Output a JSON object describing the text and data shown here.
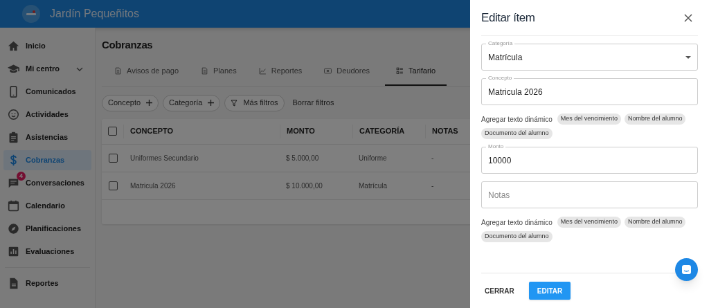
{
  "header": {
    "title": "Jardín Pequeñitos"
  },
  "sidebar": {
    "items": [
      {
        "label": "Inicio",
        "selected": false
      },
      {
        "label": "Mi centro",
        "selected": false,
        "expandable": true
      },
      {
        "label": "Comunicados",
        "selected": false
      },
      {
        "label": "Actividades",
        "selected": false
      },
      {
        "label": "Asistencias",
        "selected": false
      },
      {
        "label": "Cobranzas",
        "selected": true
      },
      {
        "label": "Conversaciones",
        "selected": false,
        "badge": "4"
      },
      {
        "label": "Calendario",
        "selected": false
      },
      {
        "label": "Planificaciones",
        "selected": false
      },
      {
        "label": "Evaluaciones",
        "selected": false
      },
      {
        "label": "Reportes",
        "selected": false,
        "separated": true
      }
    ]
  },
  "page": {
    "title": "Cobranzas",
    "tabs": [
      {
        "label": "Avisos de pago",
        "selected": false
      },
      {
        "label": "Planes",
        "selected": false
      },
      {
        "label": "Reportes",
        "selected": false
      },
      {
        "label": "Deudores",
        "selected": false
      },
      {
        "label": "Tarifario",
        "selected": true
      }
    ],
    "filters": [
      {
        "label": "Concepto",
        "kind": "add"
      },
      {
        "label": "Categoría",
        "kind": "add"
      },
      {
        "label": "Más filtros",
        "kind": "filter"
      },
      {
        "label": "Borrar filtros",
        "kind": "text"
      }
    ],
    "table": {
      "all_checked": false,
      "columns": [
        "CONCEPTO",
        "MONTO",
        "CATEGORÍA",
        "NOTAS"
      ],
      "rows": [
        {
          "checked": false,
          "cells": [
            "Uniformes Secundario",
            "$ 5.000,00",
            "Uniforme",
            "-"
          ]
        },
        {
          "checked": false,
          "cells": [
            "Matricula 2026",
            "$ 10.000,00",
            "Matrícula",
            "-"
          ]
        }
      ]
    }
  },
  "drawer": {
    "title": "Editar ítem",
    "sections": [
      {
        "kind": "select",
        "label": "Categoría",
        "value": "Matrícula"
      },
      {
        "kind": "field",
        "label": "Concepto",
        "value": "Matricula 2026"
      },
      {
        "kind": "chips",
        "label": "Agregar texto dinámico",
        "chips": [
          "Mes del vencimiento",
          "Nombre del alumno",
          "Documento del alumno"
        ]
      },
      {
        "kind": "field",
        "label": "Monto",
        "value": "10000"
      },
      {
        "kind": "field",
        "placeholder": "Notas"
      },
      {
        "kind": "chips",
        "label": "Agregar texto dinámico",
        "chips": [
          "Mes del vencimiento",
          "Nombre del alumno",
          "Documento del alumno"
        ]
      }
    ],
    "buttons": [
      {
        "label": "CERRAR",
        "kind": "text"
      },
      {
        "label": "EDITAR",
        "kind": "primary"
      }
    ]
  }
}
